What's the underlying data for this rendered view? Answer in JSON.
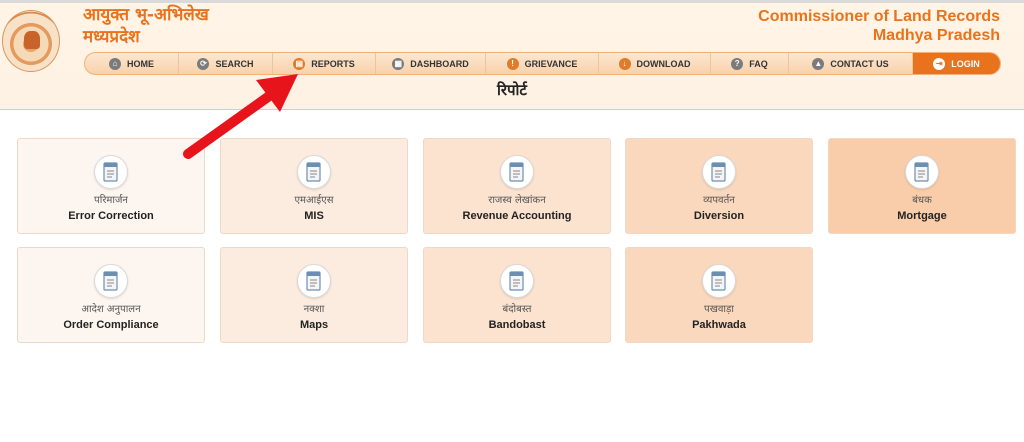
{
  "header": {
    "hi_title_line1": "आयुक्त भू-अभिलेख",
    "hi_title_line2": "मध्यप्रदेश",
    "en_title_line1": "Commissioner of Land Records",
    "en_title_line2": "Madhya Pradesh"
  },
  "nav": [
    {
      "label": "HOME",
      "icon": "home-icon"
    },
    {
      "label": "SEARCH",
      "icon": "search-icon"
    },
    {
      "label": "REPORTS",
      "icon": "report-icon"
    },
    {
      "label": "DASHBOARD",
      "icon": "dashboard-icon"
    },
    {
      "label": "GRIEVANCE",
      "icon": "grievance-icon"
    },
    {
      "label": "DOWNLOAD",
      "icon": "download-icon"
    },
    {
      "label": "FAQ",
      "icon": "faq-icon"
    },
    {
      "label": "CONTACT US",
      "icon": "contact-icon"
    },
    {
      "label": "LOGIN",
      "icon": "login-icon"
    }
  ],
  "page_heading": "रिपोर्ट",
  "tiles": [
    {
      "hi": "परिमार्जन",
      "en": "Error Correction",
      "bg": "#fdf6f0"
    },
    {
      "hi": "एमआईएस",
      "en": "MIS",
      "bg": "#fcecdf"
    },
    {
      "hi": "राजस्व लेखांकन",
      "en": "Revenue Accounting",
      "bg": "#fbe3cf"
    },
    {
      "hi": "व्यपवर्तन",
      "en": "Diversion",
      "bg": "#fad8bd"
    },
    {
      "hi": "बंधक",
      "en": "Mortgage",
      "bg": "#f9cdaa"
    },
    {
      "hi": "आदेश अनुपालन",
      "en": "Order Compliance",
      "bg": "#fdf6f0"
    },
    {
      "hi": "नक्शा",
      "en": "Maps",
      "bg": "#fcecdf"
    },
    {
      "hi": "बंदोबस्त",
      "en": "Bandobast",
      "bg": "#fbe3cf"
    },
    {
      "hi": "पखवाड़ा",
      "en": "Pakhwada",
      "bg": "#fad8bd"
    }
  ],
  "colors": {
    "accent": "#e8731c",
    "arrow": "#e8141b"
  }
}
